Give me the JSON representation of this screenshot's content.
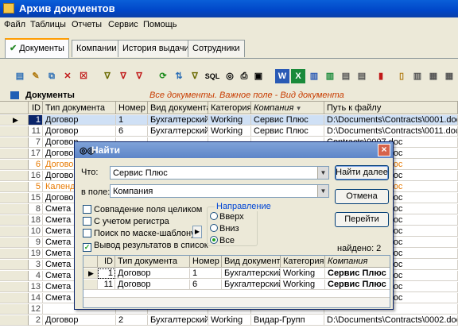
{
  "window": {
    "title": "Архив документов"
  },
  "menu": [
    "Файл",
    "Таблицы",
    "Отчеты",
    "Сервис",
    "Помощь"
  ],
  "tabs": [
    "Документы",
    "Компании",
    "История выдачи",
    "Сотрудники"
  ],
  "toolbar": {
    "labels": [
      "SQL"
    ]
  },
  "grid": {
    "title": "Документы",
    "hint": "Все документы. Важное поле - Вид документа",
    "columns": [
      "ID",
      "Тип документа",
      "Номер",
      "Вид документа",
      "Категория",
      "Компания",
      "Путь к файлу"
    ],
    "rows": [
      {
        "id": "1",
        "type": "Договор",
        "num": "1",
        "kind": "Бухгалтерский",
        "cat": "Working",
        "company": "Сервис Плюс",
        "path": "D:\\Documents\\Contracts\\0001.doc",
        "style": "current"
      },
      {
        "id": "11",
        "type": "Договор",
        "num": "6",
        "kind": "Бухгалтерский",
        "cat": "Working",
        "company": "Сервис Плюс",
        "path": "D:\\Documents\\Contracts\\0011.doc",
        "style": "normal"
      },
      {
        "id": "7",
        "type": "Договор",
        "num": "",
        "kind": "",
        "cat": "",
        "company": "",
        "path": "Contracts\\0007.doc",
        "style": "normal"
      },
      {
        "id": "17",
        "type": "Договор",
        "num": "",
        "kind": "",
        "cat": "",
        "company": "",
        "path": "Contracts\\0017.doc",
        "style": "normal"
      },
      {
        "id": "6",
        "type": "Договор",
        "num": "",
        "kind": "",
        "cat": "",
        "company": "",
        "path": "Contracts\\0006.doc",
        "style": "orange"
      },
      {
        "id": "16",
        "type": "Договор",
        "num": "",
        "kind": "",
        "cat": "",
        "company": "",
        "path": "Contracts\\0016.doc",
        "style": "normal"
      },
      {
        "id": "5",
        "type": "Календа",
        "num": "",
        "kind": "",
        "cat": "",
        "company": "",
        "path": "Contracts\\0005.doc",
        "style": "orange"
      },
      {
        "id": "15",
        "type": "Договор",
        "num": "",
        "kind": "",
        "cat": "",
        "company": "",
        "path": "Contracts\\0015.doc",
        "style": "normal"
      },
      {
        "id": "8",
        "type": "Смета",
        "num": "",
        "kind": "",
        "cat": "",
        "company": "",
        "path": "Contracts\\0008.doc",
        "style": "normal"
      },
      {
        "id": "18",
        "type": "Смета",
        "num": "",
        "kind": "",
        "cat": "",
        "company": "",
        "path": "Contracts\\0018.doc",
        "style": "normal"
      },
      {
        "id": "10",
        "type": "Смета",
        "num": "",
        "kind": "",
        "cat": "",
        "company": "",
        "path": "Contracts\\0010.doc",
        "style": "normal"
      },
      {
        "id": "9",
        "type": "Смета",
        "num": "",
        "kind": "",
        "cat": "",
        "company": "",
        "path": "Contracts\\0009.doc",
        "style": "normal"
      },
      {
        "id": "19",
        "type": "Смета",
        "num": "",
        "kind": "",
        "cat": "",
        "company": "",
        "path": "Contracts\\0019.doc",
        "style": "normal"
      },
      {
        "id": "3",
        "type": "Смета",
        "num": "",
        "kind": "",
        "cat": "",
        "company": "",
        "path": "Contracts\\0003.doc",
        "style": "normal"
      },
      {
        "id": "4",
        "type": "Смета",
        "num": "",
        "kind": "",
        "cat": "",
        "company": "",
        "path": "Contracts\\0004.doc",
        "style": "normal"
      },
      {
        "id": "13",
        "type": "Смета",
        "num": "",
        "kind": "",
        "cat": "",
        "company": "",
        "path": "Contracts\\0013.doc",
        "style": "normal"
      },
      {
        "id": "14",
        "type": "Смета",
        "num": "",
        "kind": "",
        "cat": "",
        "company": "",
        "path": "Contracts\\0014.doc",
        "style": "normal"
      },
      {
        "id": "12",
        "type": "",
        "num": "",
        "kind": "",
        "cat": "",
        "company": "",
        "path": "",
        "style": "normal"
      },
      {
        "id": "2",
        "type": "Договор",
        "num": "2",
        "kind": "Бухгалтерский",
        "cat": "Working",
        "company": "Видар-Групп",
        "path": "D:\\Documents\\Contracts\\0002.doc",
        "style": "normal"
      }
    ]
  },
  "dialog": {
    "title": "Найти",
    "what_label": "Что:",
    "what_value": "Сервис Плюс",
    "field_label": "в поле:",
    "field_value": "Компания",
    "find_next": "Найти далее",
    "cancel": "Отмена",
    "goto": "Перейти",
    "options": [
      {
        "label": "Совпадение поля целиком",
        "checked": false
      },
      {
        "label": "С учетом регистра",
        "checked": false
      },
      {
        "label": "Поиск по маске-шаблону",
        "checked": false
      },
      {
        "label": "Вывод результатов в список",
        "checked": true
      }
    ],
    "direction_label": "Направление",
    "directions": [
      {
        "label": "Вверх",
        "selected": false
      },
      {
        "label": "Вниз",
        "selected": false
      },
      {
        "label": "Все",
        "selected": true
      }
    ],
    "found": "найдено: 2",
    "results": {
      "columns": [
        "ID",
        "Тип документа",
        "Номер",
        "Вид документа",
        "Категория",
        "Компания"
      ],
      "rows": [
        {
          "id": "1",
          "type": "Договор",
          "num": "1",
          "kind": "Бухгалтерский",
          "cat": "Working",
          "company": "Сервис Плюс"
        },
        {
          "id": "11",
          "type": "Договор",
          "num": "6",
          "kind": "Бухгалтерский",
          "cat": "Working",
          "company": "Сервис Плюс"
        }
      ]
    }
  },
  "colors": {
    "accent": "#0046c8",
    "current_row": "#cfe0f5",
    "orange_text": "#e87a00"
  }
}
